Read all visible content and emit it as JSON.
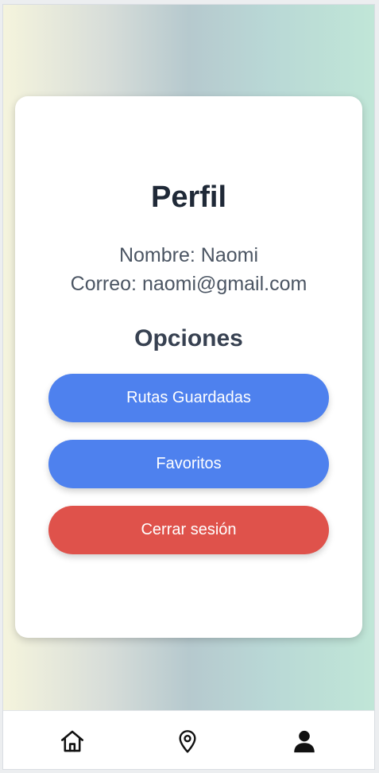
{
  "profile": {
    "title": "Perfil",
    "name_line": "Nombre: Naomi",
    "email_line": "Correo: naomi@gmail.com"
  },
  "options": {
    "title": "Opciones",
    "saved_routes_label": "Rutas Guardadas",
    "favorites_label": "Favoritos",
    "logout_label": "Cerrar sesión"
  },
  "bottom_nav": {
    "items": [
      {
        "icon": "home-icon"
      },
      {
        "icon": "location-pin-icon"
      },
      {
        "icon": "user-icon",
        "active": true
      }
    ]
  },
  "colors": {
    "primary_button": "#4e81ee",
    "danger_button": "#df524b",
    "title_text": "#1f2937",
    "gradient": [
      "#f5f4dd",
      "#b6c9ce",
      "#c0e6d7"
    ]
  }
}
